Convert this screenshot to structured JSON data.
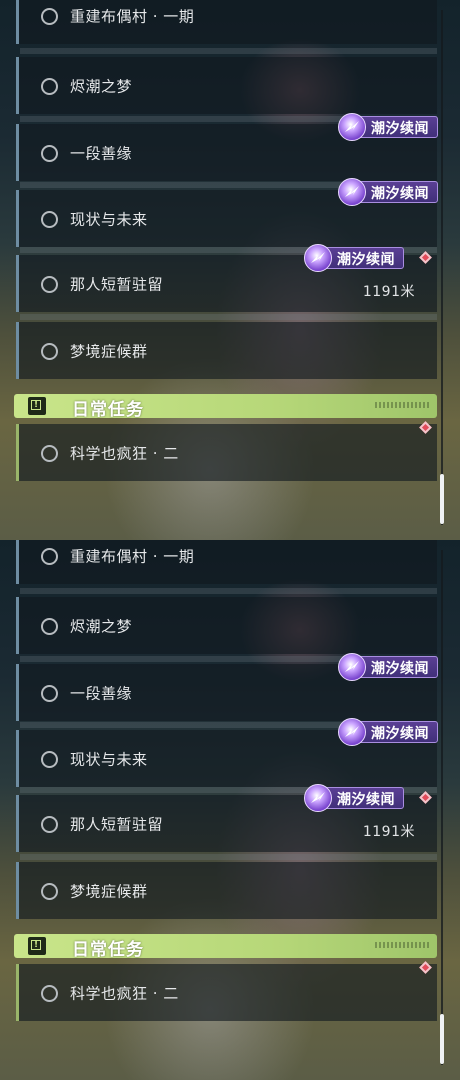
{
  "panels": [
    {
      "quests": [
        {
          "title": "重建布偶村 · 一期"
        },
        {
          "title": "烬潮之梦"
        },
        {
          "title": "一段善缘",
          "badge": "潮汐续闻"
        },
        {
          "title": "现状与未来",
          "badge": "潮汐续闻"
        },
        {
          "title": "那人短暂驻留",
          "badge": "潮汐续闻",
          "distance": "1191米"
        },
        {
          "title": "梦境症候群"
        }
      ],
      "daily": {
        "header": "日常任务",
        "quest": "科学也疯狂 · 二"
      },
      "scroll_position": 0.95
    },
    {
      "quests": [
        {
          "title": "重建布偶村 · 一期"
        },
        {
          "title": "烬潮之梦"
        },
        {
          "title": "一段善缘",
          "badge": "潮汐续闻"
        },
        {
          "title": "现状与未来",
          "badge": "潮汐续闻"
        },
        {
          "title": "那人短暂驻留",
          "badge": "潮汐续闻",
          "distance": "1191米"
        },
        {
          "title": "梦境症候群"
        }
      ],
      "daily": {
        "header": "日常任务",
        "quest": "科学也疯狂 · 二"
      },
      "scroll_position": 0.95
    }
  ],
  "colors": {
    "daily_accent": "#c9e58a",
    "badge_purple": "#4a3486",
    "tracking_marker": "#e04b5a"
  },
  "icons": [
    "circle-ring-icon",
    "tide-badge-icon",
    "daily-quest-icon",
    "tracking-diamond-icon"
  ]
}
